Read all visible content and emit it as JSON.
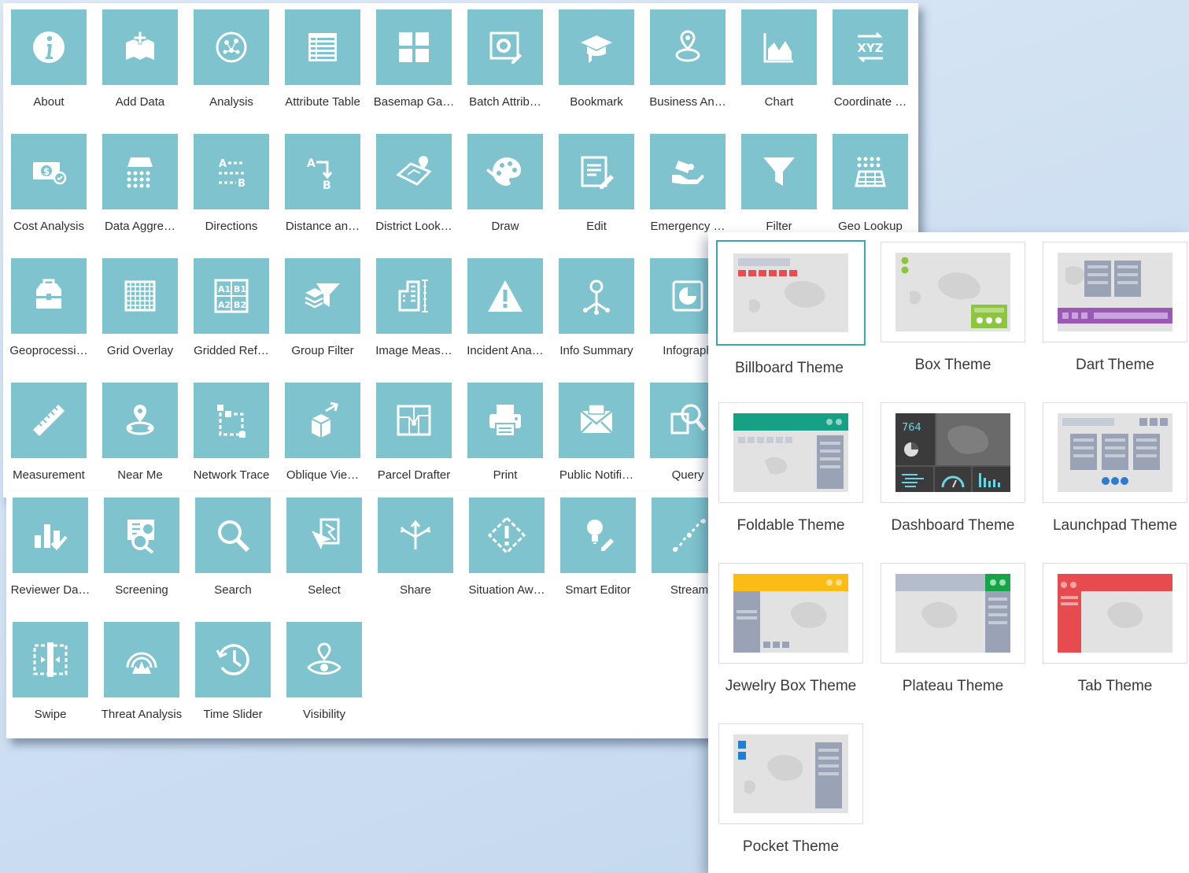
{
  "colors": {
    "tile": "#7ec3ce",
    "selected_border": "#3aa6b5"
  },
  "widgets_top": [
    {
      "label": "About",
      "icon": "info-icon"
    },
    {
      "label": "Add Data",
      "icon": "add-data-icon"
    },
    {
      "label": "Analysis",
      "icon": "analysis-icon"
    },
    {
      "label": "Attribute Table",
      "icon": "table-icon"
    },
    {
      "label": "Basemap Ga…",
      "icon": "basemap-grid-icon"
    },
    {
      "label": "Batch Attrib…",
      "icon": "batch-edit-icon"
    },
    {
      "label": "Bookmark",
      "icon": "bookmark-icon"
    },
    {
      "label": "Business An…",
      "icon": "location-pin-icon"
    },
    {
      "label": "Chart",
      "icon": "chart-icon"
    },
    {
      "label": "Coordinate …",
      "icon": "xyz-icon"
    },
    {
      "label": "Cost Analysis",
      "icon": "cost-icon"
    },
    {
      "label": "Data Aggre…",
      "icon": "aggregate-icon"
    },
    {
      "label": "Directions",
      "icon": "directions-icon"
    },
    {
      "label": "Distance an…",
      "icon": "distance-icon"
    },
    {
      "label": "District Look…",
      "icon": "district-icon"
    },
    {
      "label": "Draw",
      "icon": "palette-icon"
    },
    {
      "label": "Edit",
      "icon": "edit-icon"
    },
    {
      "label": "Emergency …",
      "icon": "emergency-icon"
    },
    {
      "label": "Filter",
      "icon": "filter-icon"
    },
    {
      "label": "Geo Lookup",
      "icon": "geo-lookup-icon"
    },
    {
      "label": "Geoprocessi…",
      "icon": "toolbox-icon"
    },
    {
      "label": "Grid Overlay",
      "icon": "grid-icon"
    },
    {
      "label": "Gridded Ref…",
      "icon": "gridded-ref-icon"
    },
    {
      "label": "Group Filter",
      "icon": "group-filter-icon"
    },
    {
      "label": "Image Meas…",
      "icon": "building-icon"
    },
    {
      "label": "Incident Ana…",
      "icon": "warning-icon"
    },
    {
      "label": "Info Summary",
      "icon": "info-summary-icon"
    },
    {
      "label": "Infograph",
      "icon": "infographic-icon"
    },
    {
      "label": "Measurement",
      "icon": "ruler-icon"
    },
    {
      "label": "Near Me",
      "icon": "near-me-icon"
    },
    {
      "label": "Network Trace",
      "icon": "network-icon"
    },
    {
      "label": "Oblique Vie…",
      "icon": "oblique-icon"
    },
    {
      "label": "Parcel Drafter",
      "icon": "parcel-icon"
    },
    {
      "label": "Print",
      "icon": "print-icon"
    },
    {
      "label": "Public Notifi…",
      "icon": "mail-icon"
    },
    {
      "label": "Query",
      "icon": "query-icon"
    }
  ],
  "widgets_bottom": [
    {
      "label": "Reviewer Da…",
      "icon": "reviewer-icon"
    },
    {
      "label": "Screening",
      "icon": "screening-icon"
    },
    {
      "label": "Search",
      "icon": "search-icon"
    },
    {
      "label": "Select",
      "icon": "select-icon"
    },
    {
      "label": "Share",
      "icon": "share-icon"
    },
    {
      "label": "Situation Aw…",
      "icon": "situation-icon"
    },
    {
      "label": "Smart Editor",
      "icon": "smart-editor-icon"
    },
    {
      "label": "Stream",
      "icon": "stream-icon"
    },
    {
      "label": "Swipe",
      "icon": "swipe-icon"
    },
    {
      "label": "Threat Analysis",
      "icon": "threat-icon"
    },
    {
      "label": "Time Slider",
      "icon": "clock-icon"
    },
    {
      "label": "Visibility",
      "icon": "visibility-icon"
    }
  ],
  "themes": [
    {
      "label": "Billboard Theme",
      "selected": true
    },
    {
      "label": "Box Theme"
    },
    {
      "label": "Dart Theme"
    },
    {
      "label": "Foldable Theme"
    },
    {
      "label": "Dashboard Theme",
      "badge": "764"
    },
    {
      "label": "Launchpad Theme"
    },
    {
      "label": "Jewelry Box Theme"
    },
    {
      "label": "Plateau Theme"
    },
    {
      "label": "Tab Theme"
    },
    {
      "label": "Pocket Theme"
    }
  ]
}
